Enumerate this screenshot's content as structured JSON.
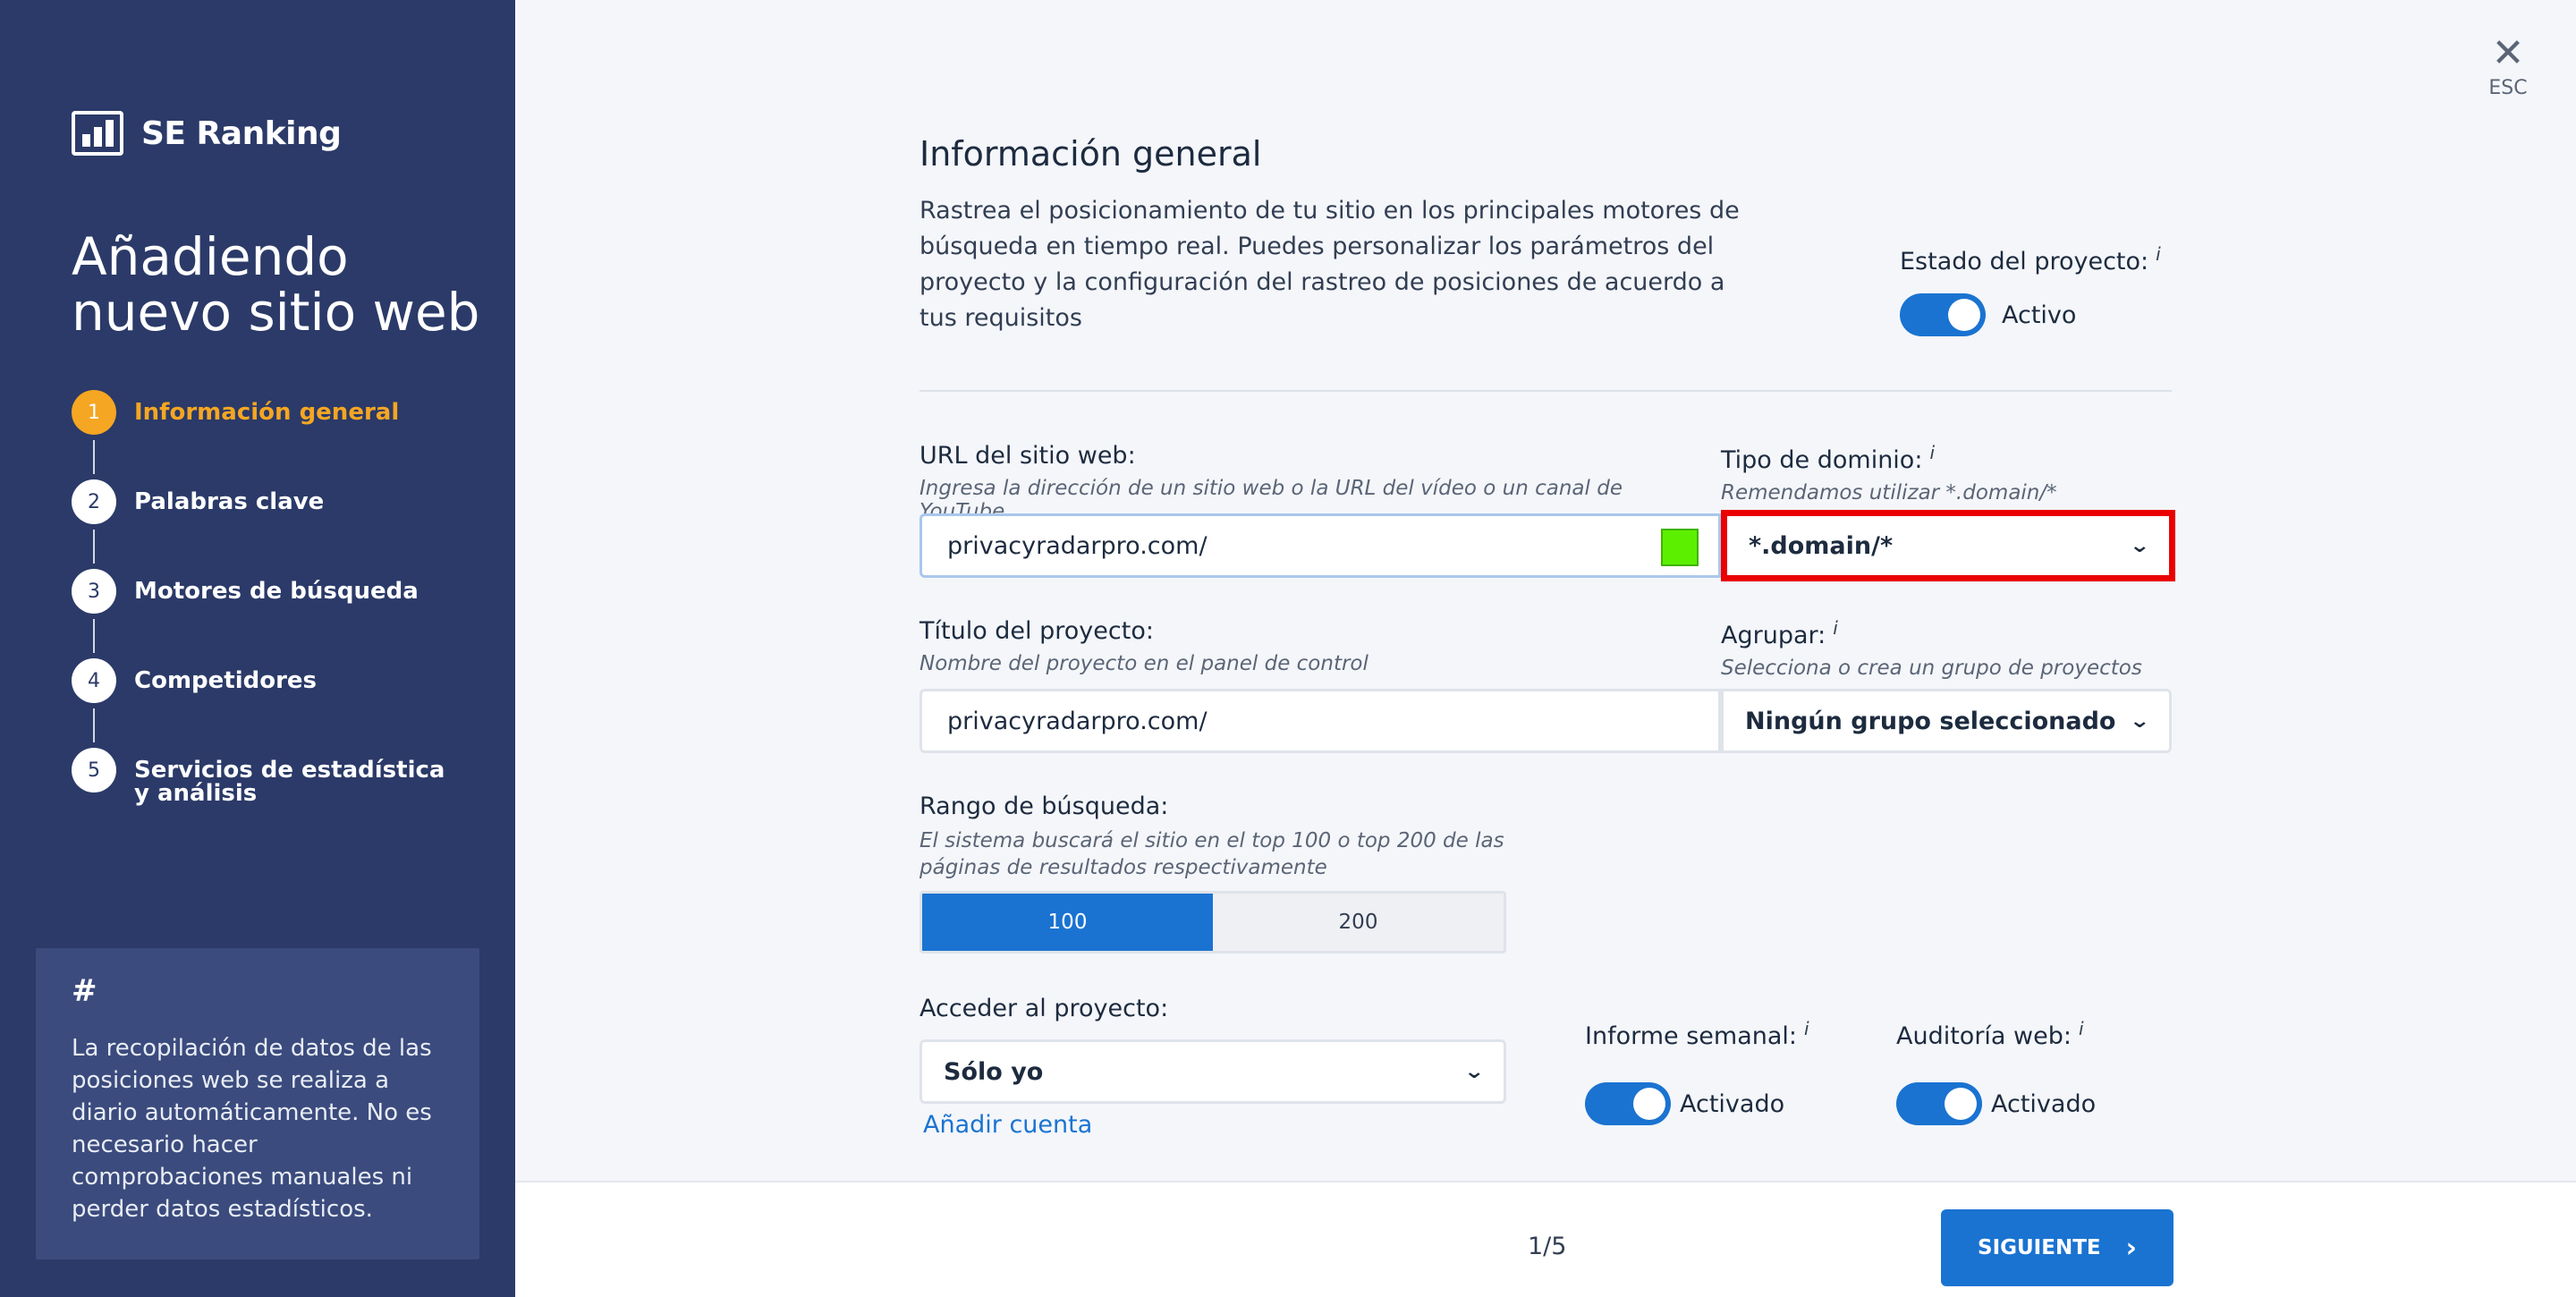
{
  "brand": {
    "name": "SE Ranking"
  },
  "sidebar": {
    "title": "Añadiendo nuevo sitio web",
    "steps": [
      {
        "num": "1",
        "label": "Información general",
        "active": true
      },
      {
        "num": "2",
        "label": "Palabras clave"
      },
      {
        "num": "3",
        "label": "Motores de búsqueda"
      },
      {
        "num": "4",
        "label": "Competidores"
      },
      {
        "num": "5",
        "label": "Servicios de estadística y análisis"
      }
    ],
    "tip": {
      "symbol": "#",
      "text": "La recopilación de datos de las posiciones web se realiza a diario automáticamente. No es necesario hacer comprobaciones manuales ni perder datos estadísticos."
    }
  },
  "close": {
    "label": "ESC"
  },
  "main": {
    "heading": "Información general",
    "intro": "Rastrea el posicionamiento de tu sitio en los principales motores de búsqueda en tiempo real. Puedes personalizar los parámetros del proyecto y la configuración del rastreo de posiciones de acuerdo a tus requisitos",
    "status": {
      "label": "Estado del proyecto:",
      "info": "i",
      "value": "Activo"
    },
    "url": {
      "label": "URL del sitio web:",
      "hint": "Ingresa la dirección de un sitio web o la URL del vídeo o un canal de YouTube",
      "value": "privacyradarpro.com/"
    },
    "domain_type": {
      "label": "Tipo de dominio:",
      "info": "i",
      "hint": "Remendamos utilizar *.domain/*",
      "value": "*.domain/*"
    },
    "project_title": {
      "label": "Título del proyecto:",
      "hint": "Nombre del proyecto en el panel de control",
      "value": "privacyradarpro.com/"
    },
    "group": {
      "label": "Agrupar:",
      "info": "i",
      "hint": "Selecciona o crea un grupo de proyectos",
      "value": "Ningún grupo seleccionado"
    },
    "range": {
      "label": "Rango de búsqueda:",
      "hint": "El sistema buscará el sitio en el top 100 o top 200 de las páginas de resultados respectivamente",
      "options": [
        "100",
        "200"
      ],
      "selected": "100"
    },
    "access": {
      "label": "Acceder al proyecto:",
      "value": "Sólo yo",
      "add_account": "Añadir cuenta"
    },
    "weekly_report": {
      "label": "Informe semanal:",
      "info": "i",
      "value": "Activado"
    },
    "web_audit": {
      "label": "Auditoría web:",
      "info": "i",
      "value": "Activado"
    }
  },
  "footer": {
    "pager": "1/5",
    "next_label": "SIGUIENTE"
  },
  "colors": {
    "sidebar": "#2b3a68",
    "accent": "#1a73d1",
    "active_step": "#f5a623",
    "highlight": "#ea0000"
  }
}
